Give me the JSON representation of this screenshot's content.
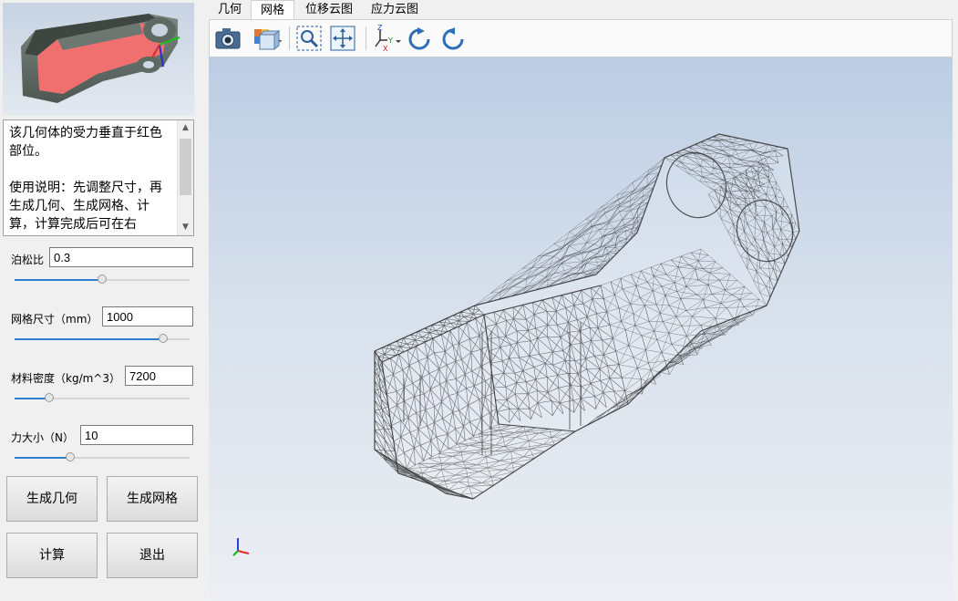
{
  "menu": {
    "tabs": [
      {
        "label": "几何"
      },
      {
        "label": "网格"
      },
      {
        "label": "位移云图"
      },
      {
        "label": "应力云图"
      }
    ],
    "active": "网格"
  },
  "toolbar": {
    "buttons": [
      {
        "icon": "camera-icon"
      },
      {
        "icon": "view-cube-icon"
      },
      {
        "icon": "zoom-window-icon"
      },
      {
        "icon": "fit-all-icon"
      },
      {
        "icon": "axis-orientation-icon"
      },
      {
        "icon": "rotate-clockwise-icon"
      },
      {
        "icon": "rotate-counterclockwise-icon"
      }
    ],
    "axis_letters": {
      "z": "Z",
      "y": "Y",
      "x": "X"
    }
  },
  "description": {
    "text": "该几何体的受力垂直于红色部位。\n\n使用说明：先调整尺寸，再生成几何、生成网格、计算，计算完成后可在右"
  },
  "params": {
    "poisson": {
      "label": "泊松比",
      "value": "0.3",
      "slider": 0.5
    },
    "mesh_size": {
      "label": "网格尺寸（mm）",
      "value": "1000",
      "slider": 0.85
    },
    "density": {
      "label": "材料密度（kg/m^3）",
      "value": "7200",
      "slider": 0.2
    },
    "force": {
      "label": "力大小（N）",
      "value": "10",
      "slider": 0.32
    }
  },
  "buttons": {
    "gen_geometry": "生成几何",
    "gen_mesh": "生成网格",
    "compute": "计算",
    "exit": "退出"
  },
  "colors": {
    "slider_accent": "#2f7fd0",
    "load_face": "#f07070",
    "part_body": "#5f6b64",
    "mesh_line": "#3a3a3a"
  }
}
